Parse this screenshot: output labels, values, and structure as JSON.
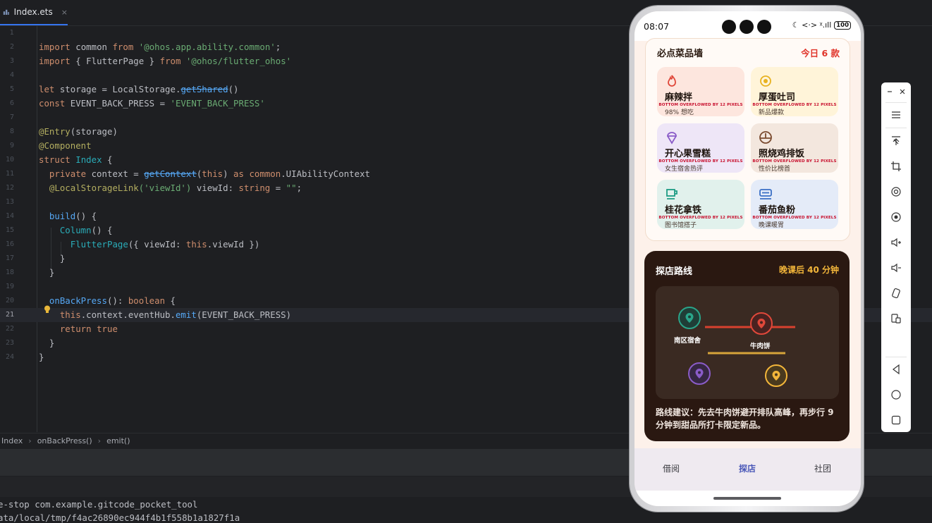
{
  "ide": {
    "tab": {
      "label": "Index.ets",
      "close": "×"
    },
    "code_lines": [
      {
        "n": "1"
      },
      {
        "n": "2"
      },
      {
        "n": "3"
      },
      {
        "n": "4"
      },
      {
        "n": "5"
      },
      {
        "n": "6"
      },
      {
        "n": "7"
      },
      {
        "n": "8"
      },
      {
        "n": "9"
      },
      {
        "n": "10"
      },
      {
        "n": "11"
      },
      {
        "n": "12"
      },
      {
        "n": "13"
      },
      {
        "n": "14"
      },
      {
        "n": "15"
      },
      {
        "n": "16"
      },
      {
        "n": "17"
      },
      {
        "n": "18"
      },
      {
        "n": "19"
      },
      {
        "n": "20"
      },
      {
        "n": "21"
      },
      {
        "n": "22"
      },
      {
        "n": "23"
      },
      {
        "n": "24"
      }
    ],
    "tokens": {
      "import": "import",
      "common": "common",
      "from": "from",
      "ability_common": "'@ohos.app.ability.common'",
      "semi": ";",
      "lbrace_sp": "{ ",
      "FlutterPage": "FlutterPage",
      "rbrace_sp": " }",
      "flutter_ohos": "'@ohos/flutter_ohos'",
      "let": "let",
      "storage_eq": " storage = ",
      "LocalStorage": "LocalStorage.",
      "getShared": "getShared",
      "parens": "()",
      "const": "const",
      "event_const": " EVENT_BACK_PRESS = ",
      "event_str": "'EVENT_BACK_PRESS'",
      "entry": "@Entry",
      "entry_arg": "(storage)",
      "component": "@Component",
      "struct": "struct",
      "Index": "Index",
      "open": " {",
      "private": "private",
      "context_eq": " context = ",
      "getContext": "getContext",
      "this_arg_open": "(",
      "this": "this",
      "this_arg_close": ")",
      "as": " as ",
      "common_dot": "common",
      "UIAbilityContext": ".UIAbilityContext",
      "link": "@LocalStorageLink",
      "link_arg": "('viewId')",
      "viewid_decl": " viewId: ",
      "string": "string",
      "empty_assign": " = ",
      "empty_str": "\"\"",
      "semi2": ";",
      "build": "build",
      "build_tail": "() {",
      "Column": "Column",
      "column_tail": "() {",
      "flutter_call": "FlutterPage",
      "flutter_args_a": "({ viewId: ",
      "flutter_this": "this",
      "flutter_args_b": ".viewId })",
      "close_brace": "}",
      "onBackPress": "onBackPress",
      "onback_tail": "(): ",
      "boolean": "boolean",
      "onback_open": " {",
      "ctx_a": ".context.eventHub.",
      "emit": "emit",
      "emit_open": "(",
      "emit_arg": "EVENT_BACK_PRESS",
      "emit_close": ")",
      "return": "return",
      "true": "true"
    },
    "breadcrumb": [
      "Index",
      "onBackPress()",
      "emit()"
    ],
    "console_lines": [
      "e-stop com.example.gitcode_pocket_tool",
      "ata/local/tmp/f4ac26890ec944f4b1f558b1a1827f1a"
    ]
  },
  "phone": {
    "status": {
      "time": "08:07",
      "icons": "☾ <·> ᵡ.ıll",
      "battery": "100"
    },
    "menu_wall": {
      "title": "必点菜品墙",
      "count": "今日 6 款",
      "overflow_text": "BOTTOM OVERFLOWED BY 12 PIXELS",
      "items": [
        {
          "name": "麻辣拌",
          "sub": "98% 想吃",
          "bg": "#fde6de",
          "icon_color": "#e0483a",
          "icon": "flame-icon"
        },
        {
          "name": "厚蛋吐司",
          "sub": "新品爆款",
          "bg": "#fff4d9",
          "icon_color": "#e8b21f",
          "icon": "egg-icon"
        },
        {
          "name": "开心果雪糕",
          "sub": "女生宿舍热评",
          "bg": "#eee6f7",
          "icon_color": "#8a5cc8",
          "icon": "ice-cream-icon"
        },
        {
          "name": "照烧鸡排饭",
          "sub": "性价比榜首",
          "bg": "#f3e7de",
          "icon_color": "#7a4a2e",
          "icon": "rice-bowl-icon"
        },
        {
          "name": "桂花拿铁",
          "sub": "图书馆搭子",
          "bg": "#e1f1ec",
          "icon_color": "#1d9c84",
          "icon": "coffee-icon"
        },
        {
          "name": "番茄鱼粉",
          "sub": "晚课暖胃",
          "bg": "#e4ebf8",
          "icon_color": "#3a6fc5",
          "icon": "noodle-icon"
        }
      ]
    },
    "route": {
      "title": "探店路线",
      "time": "晚课后 40 分钟",
      "stop_a": "南区宿舍",
      "stop_b": "牛肉饼",
      "tip": "路线建议：先去牛肉饼避开排队高峰，再步行 9 分钟到甜品所打卡限定新品。",
      "colors": {
        "green": "#2aa58a",
        "red": "#e0483a",
        "purple": "#8a5cc8",
        "yellow": "#f3b63a"
      }
    },
    "nav": [
      {
        "label": "借阅",
        "active": false
      },
      {
        "label": "探店",
        "active": true
      },
      {
        "label": "社团",
        "active": false
      }
    ]
  },
  "emulator_toolbar": {
    "items": [
      "minimize-icon",
      "close-icon",
      "menu-icon",
      "pin-top-icon",
      "crop-icon",
      "rotate-icon",
      "screenshot-icon",
      "volume-up-icon",
      "volume-down-icon",
      "rotate-device-icon",
      "multi-screen-icon",
      "back-icon",
      "home-icon",
      "recents-icon"
    ]
  }
}
